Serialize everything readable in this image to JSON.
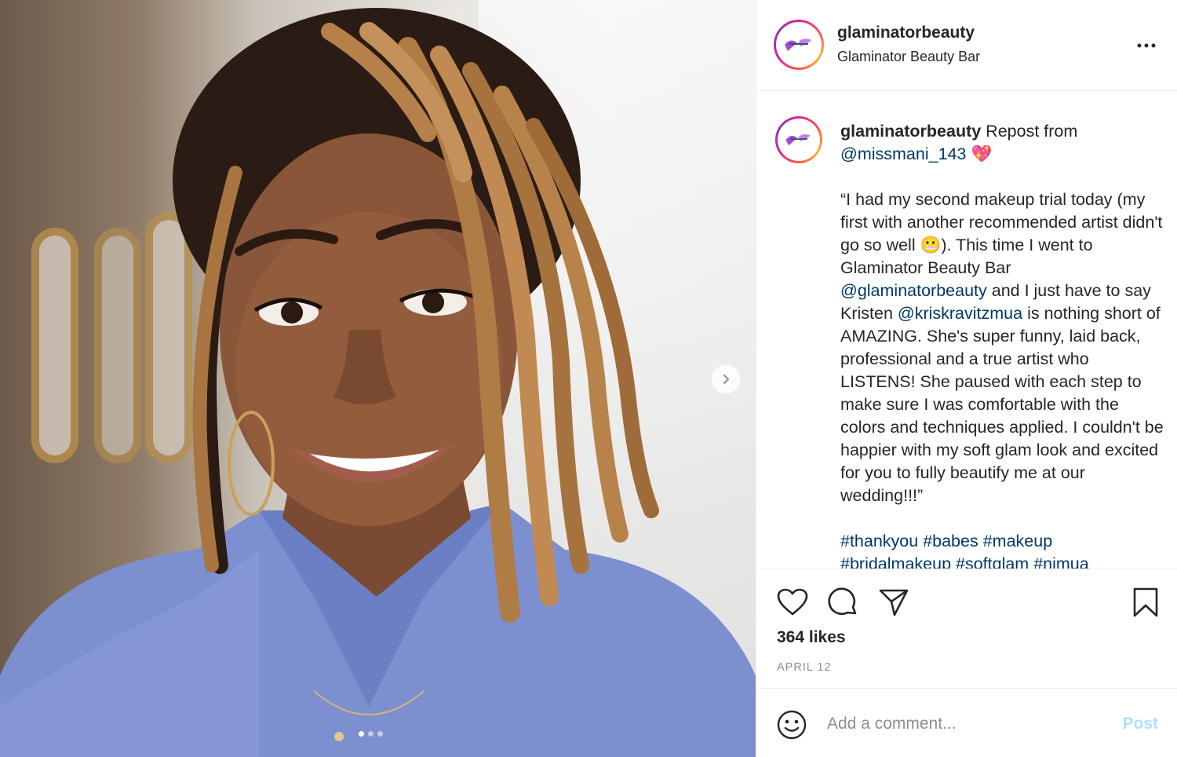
{
  "post": {
    "username": "glaminatorbeauty",
    "location": "Glaminator Beauty Bar"
  },
  "caption": {
    "username": "glaminatorbeauty",
    "intro": " Repost from",
    "repost_handle": "@missmani_143",
    "heart_emoji": "💖",
    "line_1": "“I had my second makeup trial today (my first with another recommended artist didn't go so well ",
    "grimace_emoji": "😬",
    "line_2": "). This time I went to Glaminator Beauty Bar",
    "handle_1": "@glaminatorbeauty",
    "line_3": " and I just have to say Kristen ",
    "handle_2": "@kriskravitzmua",
    "line_4": " is nothing short of AMAZING. She's super funny, laid back, professional and a true artist who LISTENS! She paused with each step to make sure I was comfortable with the colors and techniques applied. I couldn't be happier with my soft glam look and excited for you to fully beautify me at our wedding!!!”",
    "hashtags_1": "#thankyou #babes #makeup",
    "hashtags_2": "#bridalmakeup #softglam #nimua"
  },
  "stats": {
    "likes": "364 likes",
    "date": "APRIL 12"
  },
  "comment": {
    "placeholder": "Add a comment...",
    "post_label": "Post"
  },
  "carousel": {
    "total": 3,
    "active": 1
  },
  "icons": {
    "more": "more-options-icon",
    "like": "heart-icon",
    "comment": "comment-icon",
    "share": "share-icon",
    "save": "bookmark-icon",
    "emoji": "emoji-icon",
    "next": "chevron-right-icon"
  },
  "colors": {
    "link": "#00376b",
    "muted": "#8e8e8e",
    "post_button_disabled": "#b2dffc",
    "shirt": "#7a8fd0",
    "brand_purple": "#9b59d0"
  }
}
